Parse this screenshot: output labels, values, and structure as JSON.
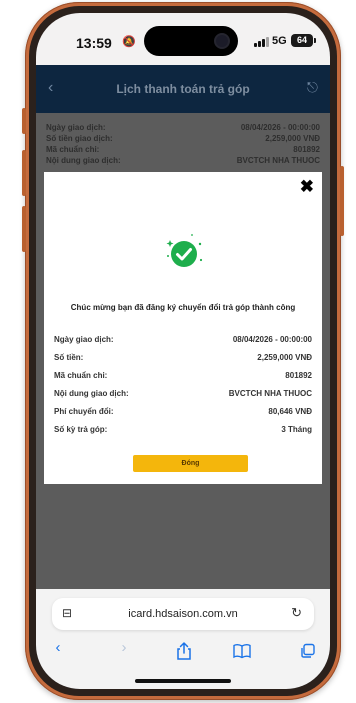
{
  "status_bar": {
    "time": "13:59",
    "network": "5G",
    "battery": "64"
  },
  "app": {
    "title": "Lịch thanh toán trả góp"
  },
  "background_rows": [
    {
      "label": "Ngày giao dịch:",
      "value": "08/04/2026 - 00:00:00"
    },
    {
      "label": "Số tiền giao dịch:",
      "value": "2,259,000 VNĐ"
    },
    {
      "label": "Mã chuẩn chi:",
      "value": "801892"
    },
    {
      "label": "Nội dung giao dịch:",
      "value": "BVCTCH NHA THUOC"
    }
  ],
  "modal": {
    "message": "Chúc mừng bạn đã đăng ký chuyển đổi trả góp thành công",
    "rows": [
      {
        "label": "Ngày giao dịch:",
        "value": "08/04/2026 - 00:00:00"
      },
      {
        "label": "Số tiền:",
        "value": "2,259,000 VNĐ"
      },
      {
        "label": "Mã chuẩn chi:",
        "value": "801892"
      },
      {
        "label": "Nội dung giao dịch:",
        "value": "BVCTCH NHA THUOC"
      },
      {
        "label": "Phí chuyển đổi:",
        "value": "80,646 VNĐ"
      },
      {
        "label": "Số kỳ trả góp:",
        "value": "3 Tháng"
      }
    ],
    "close_label": "Đóng",
    "accent_color": "#f4b60c",
    "success_color": "#1eae4c"
  },
  "browser": {
    "url": "icard.hdsaison.com.vn"
  },
  "icons": {
    "back": "chevron-left-icon",
    "forward": "chevron-right-icon",
    "share": "share-icon",
    "bookmarks": "book-icon",
    "tabs": "tabs-icon",
    "reload": "reload-icon",
    "close": "close-icon"
  }
}
